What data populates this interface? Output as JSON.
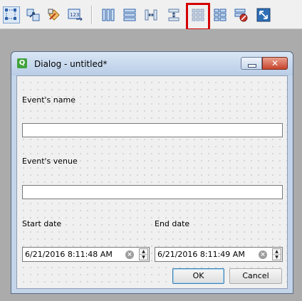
{
  "toolbar": {
    "items": [
      {
        "name": "edit-widgets"
      },
      {
        "name": "edit-signals-slots"
      },
      {
        "name": "edit-buddies"
      },
      {
        "name": "edit-tab-order"
      },
      {
        "name": "lay-out-horizontally"
      },
      {
        "name": "lay-out-vertically"
      },
      {
        "name": "lay-out-horizontally-in-splitter"
      },
      {
        "name": "lay-out-vertically-in-splitter"
      },
      {
        "name": "lay-out-in-grid",
        "highlighted": true
      },
      {
        "name": "lay-out-in-form-layout"
      },
      {
        "name": "break-layout"
      },
      {
        "name": "adjust-size"
      }
    ],
    "highlight_color": "#d50000"
  },
  "dialog": {
    "title": "Dialog - untitled*",
    "close_glyph": "✕",
    "app_icon_glyph": "Q"
  },
  "form": {
    "event_name_label": "Event's name",
    "event_name_value": "",
    "event_venue_label": "Event's venue",
    "event_venue_value": "",
    "start_date_label": "Start date",
    "start_date_value": "6/21/2016 8:11:48 AM",
    "end_date_label": "End date",
    "end_date_value": "6/21/2016 8:11:49 AM",
    "clear_glyph": "×",
    "spin_up_glyph": "▲",
    "spin_down_glyph": "▼"
  },
  "buttons": {
    "ok": "OK",
    "cancel": "Cancel"
  }
}
